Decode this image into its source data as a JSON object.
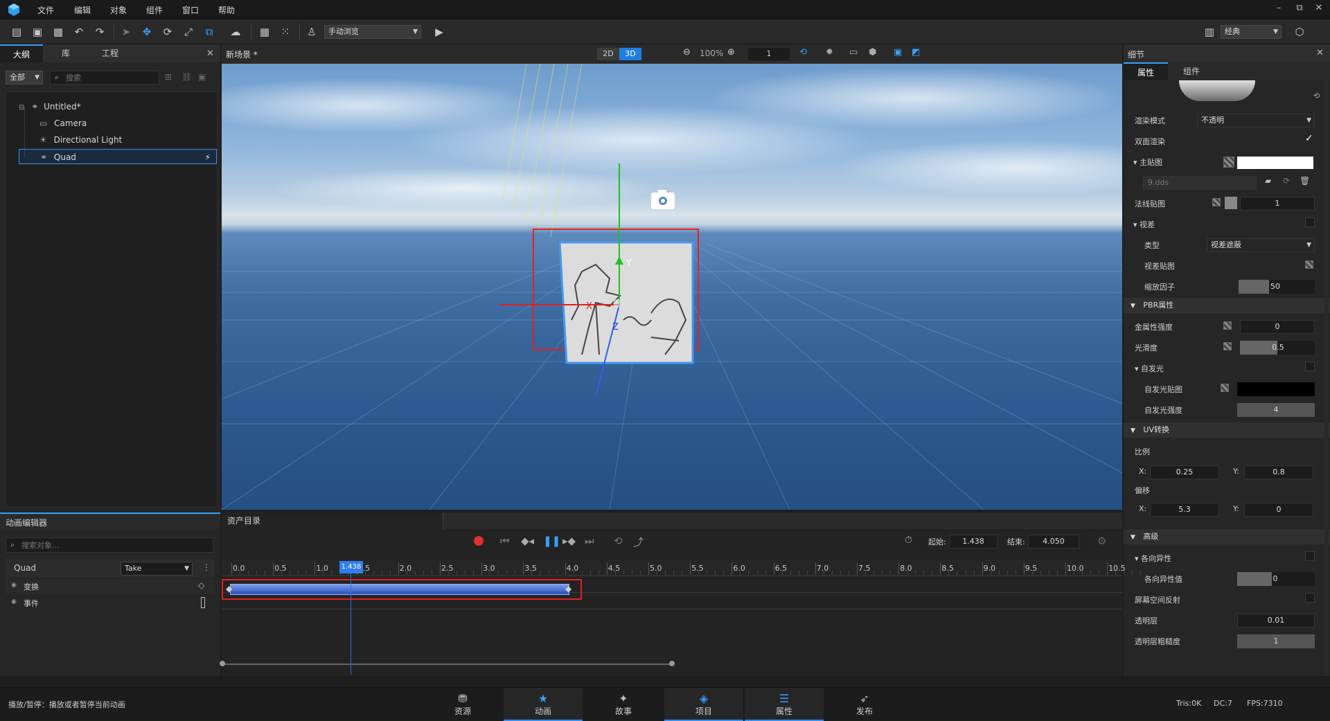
{
  "menubar": {
    "items": [
      "文件",
      "编辑",
      "对象",
      "组件",
      "窗口",
      "帮助"
    ],
    "win_min": "–",
    "win_restore": "⧉",
    "win_close": "✕"
  },
  "toolbar": {
    "view_mode": "手动浏览",
    "layout_mode": "经典"
  },
  "outline": {
    "tabs": [
      "大纲",
      "库",
      "工程"
    ],
    "filter": "全部",
    "search_placeholder": "搜索",
    "tree": [
      {
        "label": "Untitled*",
        "level": 0
      },
      {
        "label": "Camera",
        "level": 1
      },
      {
        "label": "Directional Light",
        "level": 1
      },
      {
        "label": "Quad",
        "level": 1,
        "selected": true
      }
    ]
  },
  "viewport": {
    "title": "新场景 *",
    "btn_2d": "2D",
    "btn_3d": "3D",
    "zoom": "100%",
    "count": "1",
    "axis_y": "Y",
    "axis_z": "Z",
    "axis_x": "X"
  },
  "details": {
    "title": "细节",
    "tabs": [
      "属性",
      "组件"
    ],
    "render_mode_label": "渲染模式",
    "render_mode_value": "不透明",
    "double_side_label": "双面渲染",
    "main_tex_label": "主贴图",
    "main_tex_file": "9.dds",
    "normal_tex_label": "法线贴图",
    "normal_tex_value": "1",
    "parallax_label": "视差",
    "parallax_type_label": "类型",
    "parallax_type_value": "视差遮蔽",
    "parallax_tex_label": "视差贴图",
    "scale_factor_label": "缩放因子",
    "scale_factor_value": "50",
    "pbr_section": "PBR属性",
    "metal_label": "金属性强度",
    "metal_value": "0",
    "smooth_label": "光滑度",
    "smooth_value": "0.5",
    "emissive_label": "自发光",
    "emissive_tex_label": "自发光贴图",
    "emissive_strength_label": "自发光强度",
    "emissive_strength_value": "4",
    "uv_section": "UV转换",
    "scale_label": "比例",
    "scale_x_label": "X:",
    "scale_x": "0.25",
    "scale_y_label": "Y:",
    "scale_y": "0.8",
    "offset_label": "偏移",
    "offset_x_label": "X:",
    "offset_x": "5.3",
    "offset_y_label": "Y:",
    "offset_y": "0",
    "advanced_section": "高级",
    "aniso_label": "各向异性",
    "aniso_value_label": "各向异性值",
    "aniso_value": "0",
    "ssr_label": "屏幕空间反射",
    "clearcoat_label": "透明层",
    "clearcoat_value": "0.01",
    "clearcoat_rough_label": "透明层粗糙度",
    "clearcoat_rough_value": "1"
  },
  "anim": {
    "title": "动画编辑器",
    "search_placeholder": "搜索对象...",
    "object": "Quad",
    "take": "Take",
    "tracks": [
      "变换",
      "事件"
    ]
  },
  "timeline": {
    "tab": "资产目录",
    "start_label": "起始:",
    "start_value": "1.438",
    "end_label": "结束:",
    "end_value": "4.050",
    "current": "1.438",
    "ticks": [
      "0.0",
      "0.5",
      "1.0",
      "1.5",
      "2.0",
      "2.5",
      "3.0",
      "3.5",
      "4.0",
      "4.5",
      "5.0",
      "5.5",
      "6.0",
      "6.5",
      "7.0",
      "7.5",
      "8.0",
      "8.5",
      "9.0",
      "9.5",
      "10.0",
      "10.5"
    ]
  },
  "bottombar": {
    "status": "播放/暂停：播放或者暂停当前动画",
    "tabs": [
      "资源",
      "动画",
      "故事",
      "项目",
      "属性",
      "发布"
    ],
    "tris": "Tris:0K",
    "dc": "DC:7",
    "fps": "FPS:7310"
  }
}
